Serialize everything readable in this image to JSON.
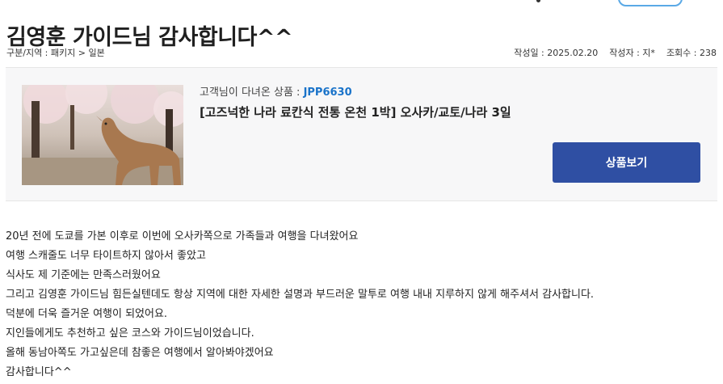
{
  "post": {
    "title": "김영훈 가이드님 감사합니다^^",
    "category": "구분/지역 : 패키지 > 일본",
    "date": "작성일 : 2025.02.20",
    "author": "작성자 : 지*",
    "views": "조회수 : 238"
  },
  "product": {
    "code_label": "고객님이 다녀온 상품 : ",
    "code": "JPP6630",
    "name": "[고즈넉한 나라 료칸식 전통 온천 1박] 오사카/교토/나라 3일",
    "view_button": "상품보기",
    "image": "deer-under-cherry-blossoms"
  },
  "content": {
    "lines": [
      "20년 전에  도쿄를 가본 이후로 이번에 오사카쪽으로 가족들과 여행을 다녀왔어요",
      "여행 스캐줄도 너무 타이트하지 않아서 좋았고",
      "식사도 제 기준에는 만족스러웠어요",
      "그리고 김영훈 가이드님 힘든실텐데도 항상 지역에 대한 자세한 설명과 부드러운 말투로 여행 내내 지루하지 않게 해주셔서 감사합니다.",
      "덕분에 더욱 즐거운 여행이 되었어요.",
      "지인들에게도 추천하고 싶은 코스와 가이드님이었습니다.",
      "올해 동남아쪽도 가고싶은데 참좋은 여행에서 알아봐야겠어요",
      "감사합니다^^"
    ]
  },
  "colors": {
    "accent_blue": "#1a73c9",
    "button_navy": "#2f4fa3",
    "box_bg": "#f7f7f8"
  }
}
